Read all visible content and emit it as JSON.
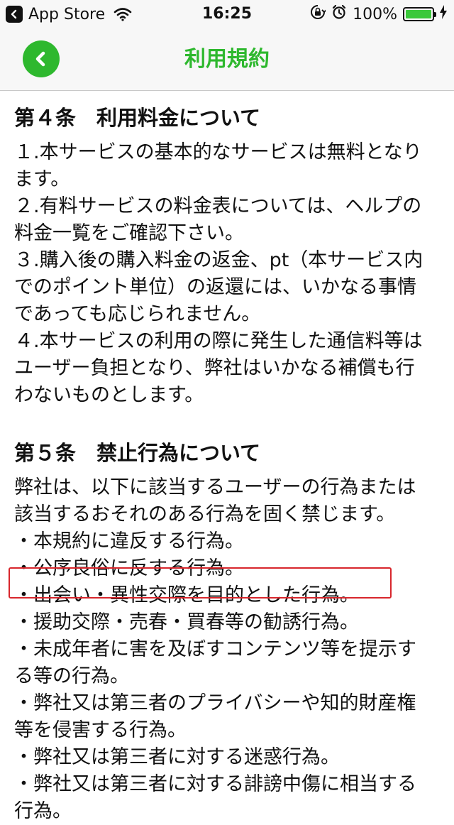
{
  "status_bar": {
    "back_app": "App Store",
    "time": "16:25",
    "battery_percent": "100%",
    "battery_level": 1.0
  },
  "nav": {
    "title": "利用規約"
  },
  "sections": [
    {
      "title": "第４条　利用料金について",
      "lines": [
        "１.本サービスの基本的なサービスは無料となり",
        "ます。",
        "２.有料サービスの料金表については、ヘルプの",
        "料金一覧をご確認下さい。",
        "３.購入後の購入料金の返金、pt（本サービス内",
        "でのポイント単位）の返還には、いかなる事情",
        "であっても応じられません。",
        "４.本サービスの利用の際に発生した通信料等は",
        "ユーザー負担となり、弊社はいかなる補償も行",
        "わないものとします。"
      ]
    },
    {
      "title": "第５条　禁止行為について",
      "lines": [
        "弊社は、以下に該当するユーザーの行為または",
        "該当するおそれのある行為を固く禁じます。",
        "・本規約に違反する行為。",
        "・公序良俗に反する行為。",
        "・出会い・異性交際を目的とした行為。",
        "・援助交際・売春・買春等の勧誘行為。",
        "・未成年者に害を及ぼすコンテンツ等を提示す",
        "る等の行為。",
        "・弊社又は第三者のプライバシーや知的財産権",
        "等を侵害する行為。",
        "・弊社又は第三者に対する迷惑行為。",
        "・弊社又は第三者に対する誹謗中傷に相当する",
        "行為。"
      ]
    }
  ],
  "colors": {
    "accent": "#2eb82e",
    "highlight_border": "#d8262c",
    "battery": "#3ac83a"
  }
}
